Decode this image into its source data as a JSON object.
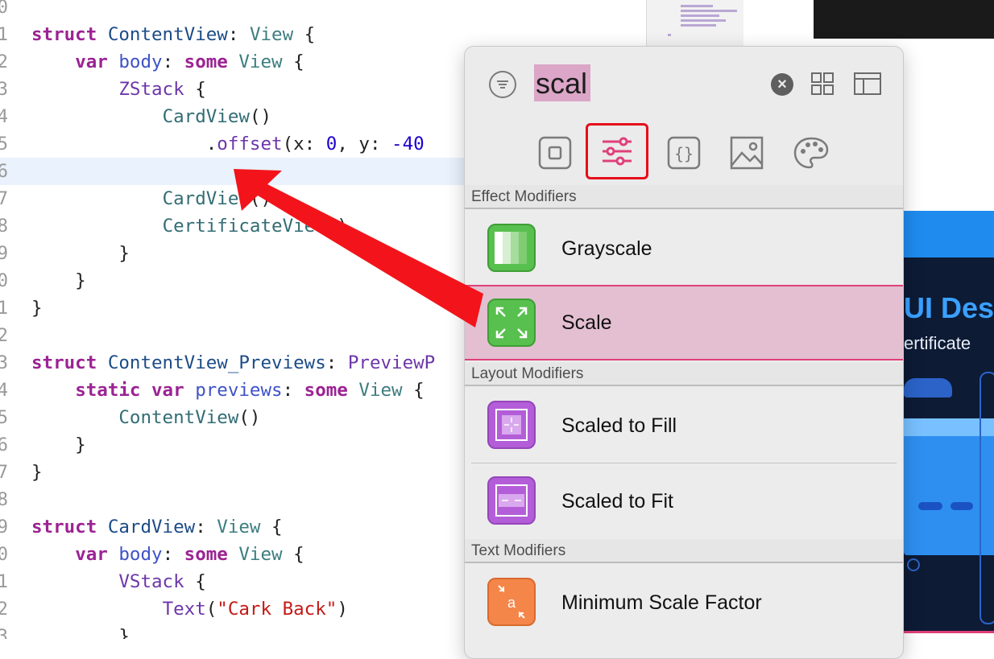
{
  "editor": {
    "lines": [
      {
        "n": "0",
        "segments": []
      },
      {
        "n": "1",
        "segments": [
          [
            "kw",
            "struct"
          ],
          [
            "pl",
            " "
          ],
          [
            "ty",
            "ContentView"
          ],
          [
            "pl",
            ": "
          ],
          [
            "ty2",
            "View"
          ],
          [
            "pl",
            " {"
          ]
        ]
      },
      {
        "n": "2",
        "segments": [
          [
            "pl",
            "    "
          ],
          [
            "kw",
            "var"
          ],
          [
            "pl",
            " "
          ],
          [
            "fn",
            "body"
          ],
          [
            "pl",
            ": "
          ],
          [
            "kw",
            "some"
          ],
          [
            "pl",
            " "
          ],
          [
            "ty2",
            "View"
          ],
          [
            "pl",
            " {"
          ]
        ]
      },
      {
        "n": "3",
        "segments": [
          [
            "pl",
            "        "
          ],
          [
            "md",
            "ZStack"
          ],
          [
            "pl",
            " {"
          ]
        ]
      },
      {
        "n": "4",
        "segments": [
          [
            "pl",
            "            "
          ],
          [
            "id",
            "CardView"
          ],
          [
            "pl",
            "()"
          ]
        ]
      },
      {
        "n": "5",
        "segments": [
          [
            "pl",
            "                ."
          ],
          [
            "md",
            "offset"
          ],
          [
            "pl",
            "(x: "
          ],
          [
            "num",
            "0"
          ],
          [
            "pl",
            ", y: "
          ],
          [
            "num",
            "-40"
          ]
        ]
      },
      {
        "n": "6",
        "segments": []
      },
      {
        "n": "7",
        "segments": [
          [
            "pl",
            "            "
          ],
          [
            "id",
            "CardView"
          ],
          [
            "pl",
            "()"
          ]
        ]
      },
      {
        "n": "8",
        "segments": [
          [
            "pl",
            "            "
          ],
          [
            "id",
            "CertificateView"
          ],
          [
            "pl",
            "()"
          ]
        ]
      },
      {
        "n": "9",
        "segments": [
          [
            "pl",
            "        }"
          ]
        ]
      },
      {
        "n": "0",
        "segments": [
          [
            "pl",
            "    }"
          ]
        ]
      },
      {
        "n": "1",
        "segments": [
          [
            "pl",
            "}"
          ]
        ]
      },
      {
        "n": "2",
        "segments": []
      },
      {
        "n": "3",
        "segments": [
          [
            "kw",
            "struct"
          ],
          [
            "pl",
            " "
          ],
          [
            "ty",
            "ContentView_Previews"
          ],
          [
            "pl",
            ": "
          ],
          [
            "md",
            "PreviewP"
          ]
        ]
      },
      {
        "n": "4",
        "segments": [
          [
            "pl",
            "    "
          ],
          [
            "kw",
            "static"
          ],
          [
            "pl",
            " "
          ],
          [
            "kw",
            "var"
          ],
          [
            "pl",
            " "
          ],
          [
            "fn",
            "previews"
          ],
          [
            "pl",
            ": "
          ],
          [
            "kw",
            "some"
          ],
          [
            "pl",
            " "
          ],
          [
            "ty2",
            "View"
          ],
          [
            "pl",
            " {"
          ]
        ]
      },
      {
        "n": "5",
        "segments": [
          [
            "pl",
            "        "
          ],
          [
            "id",
            "ContentView"
          ],
          [
            "pl",
            "()"
          ]
        ]
      },
      {
        "n": "6",
        "segments": [
          [
            "pl",
            "    }"
          ]
        ]
      },
      {
        "n": "7",
        "segments": [
          [
            "pl",
            "}"
          ]
        ]
      },
      {
        "n": "8",
        "segments": []
      },
      {
        "n": "9",
        "segments": [
          [
            "kw",
            "struct"
          ],
          [
            "pl",
            " "
          ],
          [
            "ty",
            "CardView"
          ],
          [
            "pl",
            ": "
          ],
          [
            "ty2",
            "View"
          ],
          [
            "pl",
            " {"
          ]
        ]
      },
      {
        "n": "0",
        "segments": [
          [
            "pl",
            "    "
          ],
          [
            "kw",
            "var"
          ],
          [
            "pl",
            " "
          ],
          [
            "fn",
            "body"
          ],
          [
            "pl",
            ": "
          ],
          [
            "kw",
            "some"
          ],
          [
            "pl",
            " "
          ],
          [
            "ty2",
            "View"
          ],
          [
            "pl",
            " {"
          ]
        ]
      },
      {
        "n": "1",
        "segments": [
          [
            "pl",
            "        "
          ],
          [
            "md",
            "VStack"
          ],
          [
            "pl",
            " {"
          ]
        ]
      },
      {
        "n": "2",
        "segments": [
          [
            "pl",
            "            "
          ],
          [
            "md",
            "Text"
          ],
          [
            "pl",
            "("
          ],
          [
            "str",
            "\"Cark Back\""
          ],
          [
            "pl",
            ")"
          ]
        ]
      },
      {
        "n": "3",
        "segments": [
          [
            "pl",
            "        }"
          ]
        ]
      }
    ],
    "current_line_index": 6
  },
  "library": {
    "search_text": "scal",
    "tabs": [
      {
        "key": "views",
        "icon": "views-square-icon"
      },
      {
        "key": "modifiers",
        "icon": "sliders-icon",
        "selected": true
      },
      {
        "key": "snippets",
        "icon": "braces-icon"
      },
      {
        "key": "media",
        "icon": "image-icon"
      },
      {
        "key": "colors",
        "icon": "palette-icon"
      }
    ],
    "sections": {
      "effect": "Effect Modifiers",
      "layout": "Layout Modifiers",
      "text": "Text Modifiers"
    },
    "items": {
      "grayscale": "Grayscale",
      "scale": "Scale",
      "scaled_to_fill": "Scaled to Fill",
      "scaled_to_fit": "Scaled to Fit",
      "minimum_scale_factor": "Minimum Scale Factor"
    }
  },
  "preview": {
    "title": "UI Desi",
    "subtitle": "ertificate"
  },
  "colors": {
    "accent_pink": "#e0407a",
    "annotation_red": "#e60d1b",
    "modifier_green": "#58c04e",
    "modifier_purple": "#b35ed8",
    "modifier_orange": "#f58649"
  }
}
